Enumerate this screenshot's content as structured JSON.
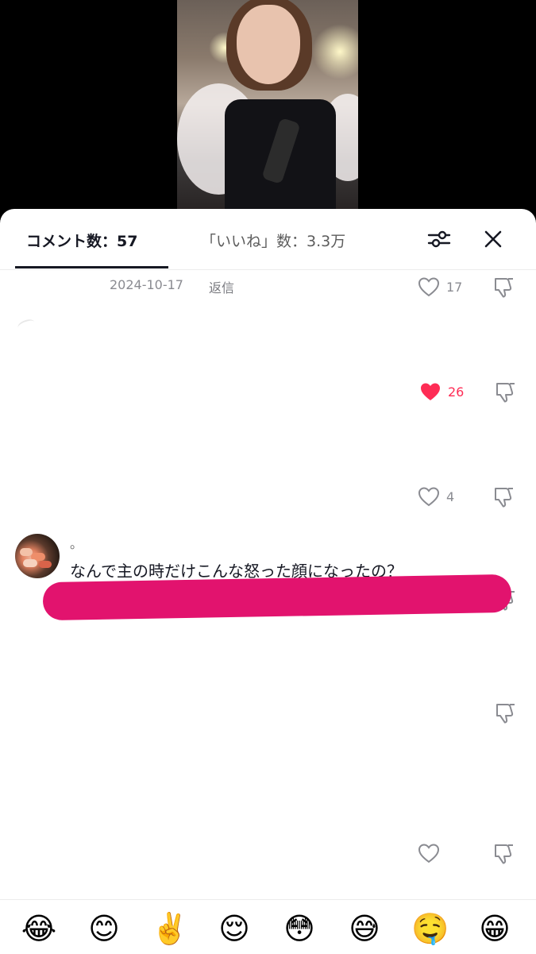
{
  "tabs": {
    "comments_label": "コメント数：57",
    "likes_label": "「いいね」数：3.3万"
  },
  "icons": {
    "filter": "sliders-icon",
    "close": "close-icon",
    "like": "heart-icon",
    "dislike": "thumbs-down-icon"
  },
  "colors": {
    "accent_liked": "#fe2c55",
    "redaction": "#e2136e"
  },
  "comments": [
    {
      "date": "2024-10-17",
      "reply_label": "返信",
      "likes": "17",
      "liked": false
    },
    {
      "likes": "26",
      "liked": true
    },
    {
      "likes": "4",
      "liked": false
    },
    {
      "username": "。",
      "text": "なんで主の時だけこんな怒った顔になったの？",
      "likes": "",
      "liked": false
    },
    {
      "likes": "",
      "liked": false
    }
  ],
  "emoji_bar": [
    "😂",
    "😊",
    "✌️",
    "😌",
    "😳",
    "😅",
    "🤤",
    "😁"
  ]
}
